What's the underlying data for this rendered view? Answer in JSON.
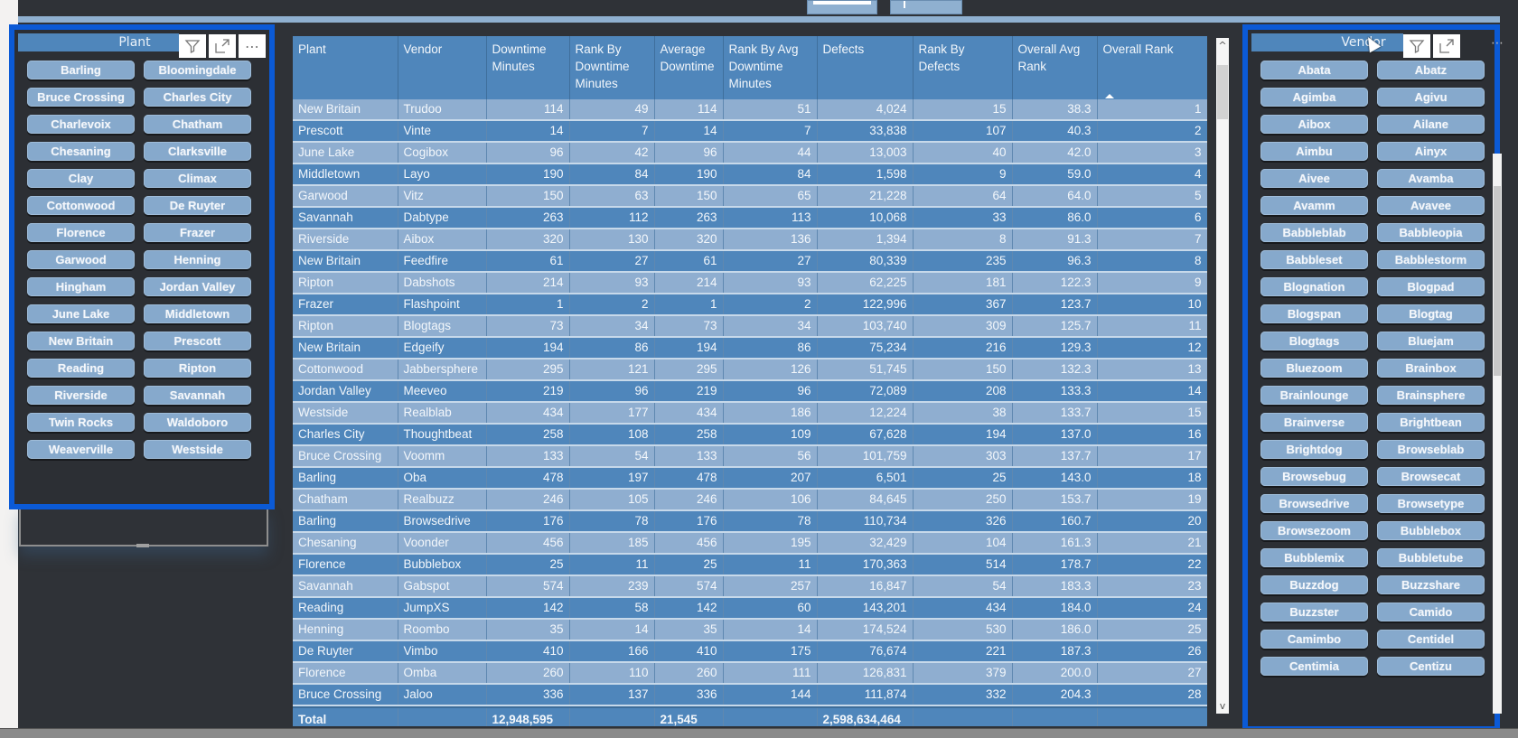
{
  "top_buttons": [
    "",
    ""
  ],
  "plant_slicer": {
    "title": "Plant",
    "icons": [
      "filter-icon",
      "focus-mode-icon",
      "more-options-icon"
    ],
    "items": [
      "Barling",
      "Bloomingdale",
      "Bruce Crossing",
      "Charles City",
      "Charlevoix",
      "Chatham",
      "Chesaning",
      "Clarksville",
      "Clay",
      "Climax",
      "Cottonwood",
      "De Ruyter",
      "Florence",
      "Frazer",
      "Garwood",
      "Henning",
      "Hingham",
      "Jordan Valley",
      "June Lake",
      "Middletown",
      "New Britain",
      "Prescott",
      "Reading",
      "Ripton",
      "Riverside",
      "Savannah",
      "Twin Rocks",
      "Waldoboro",
      "Weaverville",
      "Westside"
    ]
  },
  "vendor_slicer": {
    "title": "Vendor",
    "icons": [
      "filter-icon",
      "focus-mode-icon",
      "more-options-icon"
    ],
    "items": [
      "Abata",
      "Abatz",
      "Agimba",
      "Agivu",
      "Aibox",
      "Ailane",
      "Aimbu",
      "Ainyx",
      "Aivee",
      "Avamba",
      "Avamm",
      "Avavee",
      "Babbleblab",
      "Babbleopia",
      "Babbleset",
      "Babblestorm",
      "Blognation",
      "Blogpad",
      "Blogspan",
      "Blogtag",
      "Blogtags",
      "Bluejam",
      "Bluezoom",
      "Brainbox",
      "Brainlounge",
      "Brainsphere",
      "Brainverse",
      "Brightbean",
      "Brightdog",
      "Browseblab",
      "Browsebug",
      "Browsecat",
      "Browsedrive",
      "Browsetype",
      "Browsezoom",
      "Bubblebox",
      "Bubblemix",
      "Bubbletube",
      "Buzzdog",
      "Buzzshare",
      "Buzzster",
      "Camido",
      "Camimbo",
      "Centidel",
      "Centimia",
      "Centizu"
    ]
  },
  "table": {
    "columns": [
      "Plant",
      "Vendor",
      "Downtime Minutes",
      "Rank By Downtime Minutes",
      "Average Downtime",
      "Rank By Avg Downtime Minutes",
      "Defects",
      "Rank By Defects",
      "Overall Avg Rank",
      "Overall Rank"
    ],
    "sorted_column": "Overall Rank",
    "sort_direction": "ascending",
    "rows": [
      [
        "New Britain",
        "Trudoo",
        "114",
        "49",
        "114",
        "51",
        "4,024",
        "15",
        "38.3",
        "1"
      ],
      [
        "Prescott",
        "Vinte",
        "14",
        "7",
        "14",
        "7",
        "33,838",
        "107",
        "40.3",
        "2"
      ],
      [
        "June Lake",
        "Cogibox",
        "96",
        "42",
        "96",
        "44",
        "13,003",
        "40",
        "42.0",
        "3"
      ],
      [
        "Middletown",
        "Layo",
        "190",
        "84",
        "190",
        "84",
        "1,598",
        "9",
        "59.0",
        "4"
      ],
      [
        "Garwood",
        "Vitz",
        "150",
        "63",
        "150",
        "65",
        "21,228",
        "64",
        "64.0",
        "5"
      ],
      [
        "Savannah",
        "Dabtype",
        "263",
        "112",
        "263",
        "113",
        "10,068",
        "33",
        "86.0",
        "6"
      ],
      [
        "Riverside",
        "Aibox",
        "320",
        "130",
        "320",
        "136",
        "1,394",
        "8",
        "91.3",
        "7"
      ],
      [
        "New Britain",
        "Feedfire",
        "61",
        "27",
        "61",
        "27",
        "80,339",
        "235",
        "96.3",
        "8"
      ],
      [
        "Ripton",
        "Dabshots",
        "214",
        "93",
        "214",
        "93",
        "62,225",
        "181",
        "122.3",
        "9"
      ],
      [
        "Frazer",
        "Flashpoint",
        "1",
        "2",
        "1",
        "2",
        "122,996",
        "367",
        "123.7",
        "10"
      ],
      [
        "Ripton",
        "Blogtags",
        "73",
        "34",
        "73",
        "34",
        "103,740",
        "309",
        "125.7",
        "11"
      ],
      [
        "New Britain",
        "Edgeify",
        "194",
        "86",
        "194",
        "86",
        "75,234",
        "216",
        "129.3",
        "12"
      ],
      [
        "Cottonwood",
        "Jabbersphere",
        "295",
        "121",
        "295",
        "126",
        "51,745",
        "150",
        "132.3",
        "13"
      ],
      [
        "Jordan Valley",
        "Meeveo",
        "219",
        "96",
        "219",
        "96",
        "72,089",
        "208",
        "133.3",
        "14"
      ],
      [
        "Westside",
        "Realblab",
        "434",
        "177",
        "434",
        "186",
        "12,224",
        "38",
        "133.7",
        "15"
      ],
      [
        "Charles City",
        "Thoughtbeat",
        "258",
        "108",
        "258",
        "109",
        "67,628",
        "194",
        "137.0",
        "16"
      ],
      [
        "Bruce Crossing",
        "Voomm",
        "133",
        "54",
        "133",
        "56",
        "101,759",
        "303",
        "137.7",
        "17"
      ],
      [
        "Barling",
        "Oba",
        "478",
        "197",
        "478",
        "207",
        "6,501",
        "25",
        "143.0",
        "18"
      ],
      [
        "Chatham",
        "Realbuzz",
        "246",
        "105",
        "246",
        "106",
        "84,645",
        "250",
        "153.7",
        "19"
      ],
      [
        "Barling",
        "Browsedrive",
        "176",
        "78",
        "176",
        "78",
        "110,734",
        "326",
        "160.7",
        "20"
      ],
      [
        "Chesaning",
        "Voonder",
        "456",
        "185",
        "456",
        "195",
        "32,429",
        "104",
        "161.3",
        "21"
      ],
      [
        "Florence",
        "Bubblebox",
        "25",
        "11",
        "25",
        "11",
        "170,363",
        "514",
        "178.7",
        "22"
      ],
      [
        "Savannah",
        "Gabspot",
        "574",
        "239",
        "574",
        "257",
        "16,847",
        "54",
        "183.3",
        "23"
      ],
      [
        "Reading",
        "JumpXS",
        "142",
        "58",
        "142",
        "60",
        "143,201",
        "434",
        "184.0",
        "24"
      ],
      [
        "Henning",
        "Roombo",
        "35",
        "14",
        "35",
        "14",
        "174,524",
        "530",
        "186.0",
        "25"
      ],
      [
        "De Ruyter",
        "Vimbo",
        "410",
        "166",
        "410",
        "175",
        "76,674",
        "221",
        "187.3",
        "26"
      ],
      [
        "Florence",
        "Omba",
        "260",
        "110",
        "260",
        "111",
        "126,831",
        "379",
        "200.0",
        "27"
      ],
      [
        "Bruce Crossing",
        "Jaloo",
        "336",
        "137",
        "336",
        "144",
        "111,874",
        "332",
        "204.3",
        "28"
      ]
    ],
    "total": [
      "Total",
      "",
      "12,948,595",
      "",
      "21,545",
      "",
      "2,598,634,464",
      "",
      "",
      ""
    ]
  },
  "colors": {
    "selection_border": "#0b5ad6",
    "table_dark_row": "#4f86bb",
    "table_light_row": "#8faed0",
    "slicer_tile": "#86a9cc",
    "canvas_bg": "#2f3237"
  }
}
